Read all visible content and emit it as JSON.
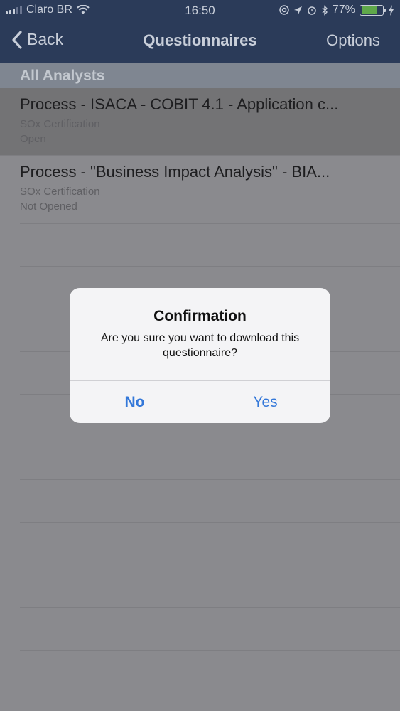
{
  "status_bar": {
    "carrier": "Claro BR",
    "time": "16:50",
    "battery_percent": "77%",
    "battery_level": 0.77
  },
  "nav": {
    "back_label": "Back",
    "title": "Questionnaires",
    "options_label": "Options"
  },
  "section": {
    "header": "All Analysts"
  },
  "rows": [
    {
      "title": "Process - ISACA - COBIT 4.1 - Application c...",
      "category": "SOx Certification",
      "status": "Open"
    },
    {
      "title": "Process - \"Business Impact Analysis\" - BIA...",
      "category": "SOx Certification",
      "status": "Not Opened"
    }
  ],
  "dialog": {
    "title": "Confirmation",
    "message": "Are you sure you want to download this questionnaire?",
    "no_label": "No",
    "yes_label": "Yes"
  },
  "colors": {
    "nav_background": "#2b3b59",
    "accent": "#3478d9",
    "battery_green": "#5fa84a"
  }
}
